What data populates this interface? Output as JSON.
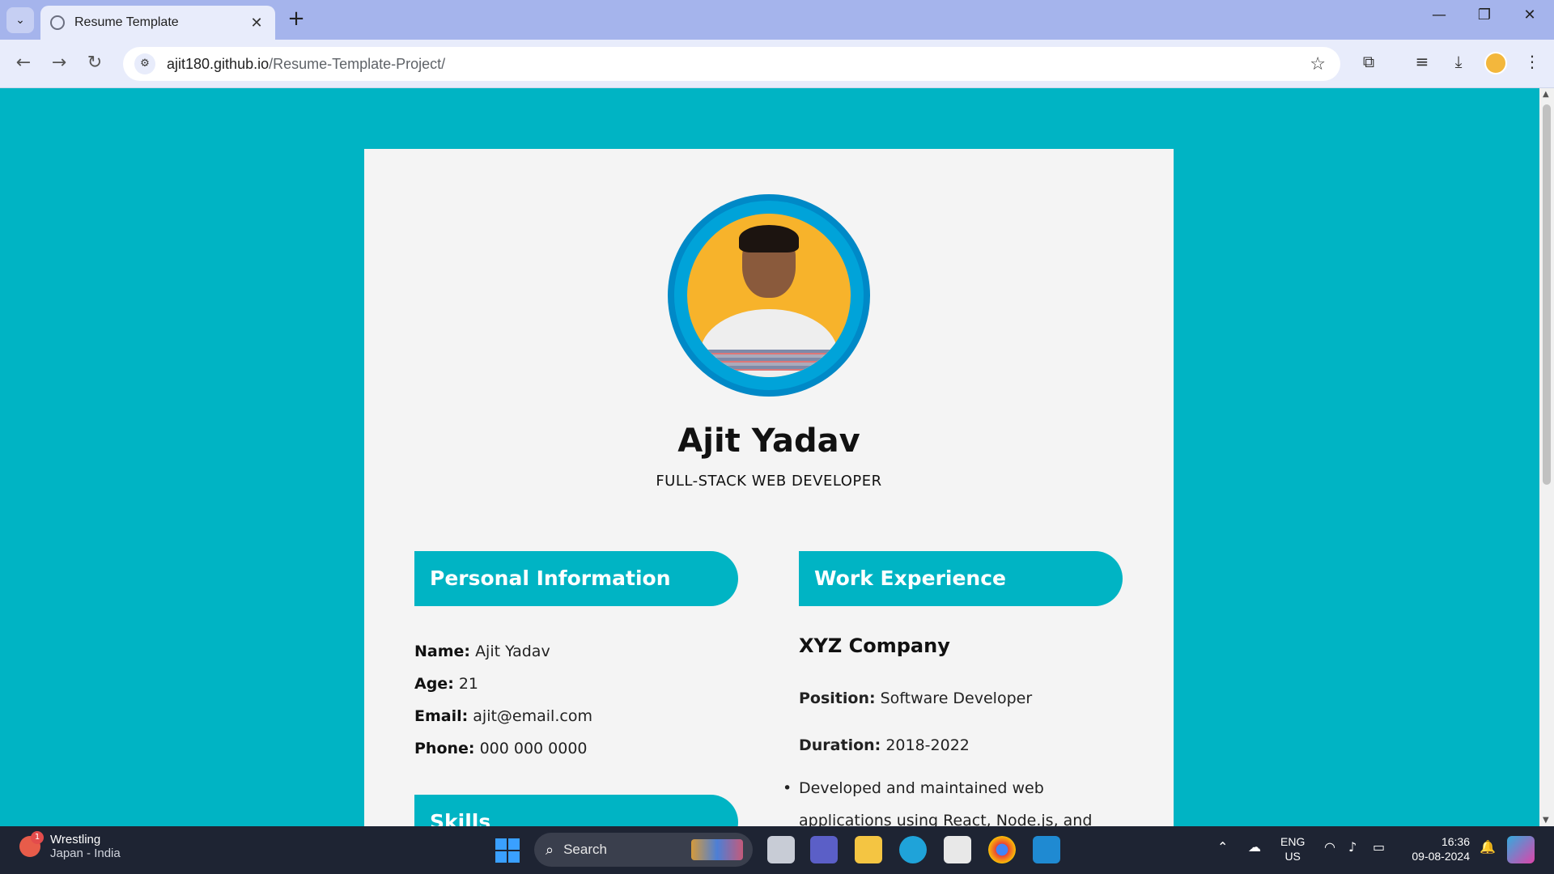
{
  "browser": {
    "tab_title": "Resume Template",
    "url_host": "ajit180.github.io",
    "url_path": "/Resume-Template-Project/"
  },
  "resume": {
    "name": "Ajit Yadav",
    "role": "FULL-STACK WEB DEVELOPER",
    "personal": {
      "heading": "Personal Information",
      "name_label": "Name:",
      "name_value": "Ajit Yadav",
      "age_label": "Age:",
      "age_value": "21",
      "email_label": "Email:",
      "email_value": "ajit@email.com",
      "phone_label": "Phone:",
      "phone_value": "000 000 0000"
    },
    "skills_heading": "Skills",
    "work": {
      "heading": "Work Experience",
      "company": "XYZ Company",
      "position_label": "Position:",
      "position_value": "Software Developer",
      "duration_label": "Duration:",
      "duration_value": "2018-2022",
      "bullet_1_line_1": "Developed and maintained web",
      "bullet_1_line_2": "applications using React, Node.js, and"
    }
  },
  "taskbar": {
    "weather_title": "Wrestling",
    "weather_subtitle": "Japan - India",
    "weather_badge": "1",
    "search_label": "Search",
    "lang_1": "ENG",
    "lang_2": "US",
    "time": "16:36",
    "date": "09-08-2024"
  },
  "colors": {
    "page_bg": "#00b4c4",
    "section_head": "#00b4c4",
    "card_bg": "#f4f4f4",
    "tabbar": "#a5b4ec"
  }
}
